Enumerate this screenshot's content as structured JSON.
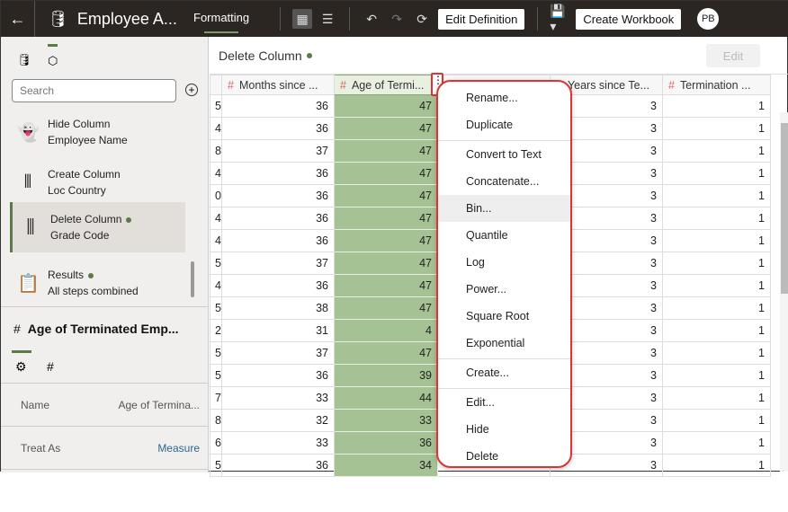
{
  "header": {
    "title": "Employee A...",
    "formatting_tab": "Formatting",
    "edit_definition": "Edit Definition",
    "create_workbook": "Create Workbook",
    "avatar": "PB"
  },
  "sidebar": {
    "search_placeholder": "Search",
    "steps": [
      {
        "title": "Hide Column",
        "subtitle": "Employee Name",
        "icon": "ghost-icon"
      },
      {
        "title": "Create Column",
        "subtitle": "Loc Country",
        "icon": "create-column-icon"
      },
      {
        "title": "Delete Column",
        "subtitle": "Grade Code",
        "icon": "delete-column-icon",
        "selected": true
      },
      {
        "title": "Results",
        "subtitle": "All steps combined",
        "icon": "results-icon"
      }
    ],
    "properties": {
      "title": "Age of Terminated Emp...",
      "rows": [
        {
          "label": "Name",
          "value": "Age of Termina..."
        },
        {
          "label": "Treat As",
          "value": "Measure"
        }
      ]
    }
  },
  "main": {
    "step_title": "Delete Column",
    "edit_label": "Edit",
    "columns": [
      "",
      "Months since ...",
      "Age of Termi...",
      "",
      "Years since Te...",
      "Termination ..."
    ],
    "rows": [
      [
        "5",
        "36",
        "47",
        "",
        "3",
        "1"
      ],
      [
        "4",
        "36",
        "47",
        "",
        "3",
        "1"
      ],
      [
        "8",
        "37",
        "47",
        "",
        "3",
        "1"
      ],
      [
        "4",
        "36",
        "47",
        "",
        "3",
        "1"
      ],
      [
        "0",
        "36",
        "47",
        "",
        "3",
        "1"
      ],
      [
        "4",
        "36",
        "47",
        "",
        "3",
        "1"
      ],
      [
        "4",
        "36",
        "47",
        "",
        "3",
        "1"
      ],
      [
        "5",
        "37",
        "47",
        "",
        "3",
        "1"
      ],
      [
        "4",
        "36",
        "47",
        "",
        "3",
        "1"
      ],
      [
        "5",
        "38",
        "47",
        "",
        "3",
        "1"
      ],
      [
        "2",
        "31",
        "4",
        "",
        "3",
        "1"
      ],
      [
        "5",
        "37",
        "47",
        "",
        "3",
        "1"
      ],
      [
        "5",
        "36",
        "39",
        "",
        "3",
        "1"
      ],
      [
        "7",
        "33",
        "44",
        "",
        "3",
        "1"
      ],
      [
        "8",
        "32",
        "33",
        "",
        "3",
        "1"
      ],
      [
        "6",
        "33",
        "36",
        "",
        "3",
        "1"
      ],
      [
        "5",
        "36",
        "34",
        "",
        "3",
        "1"
      ]
    ]
  },
  "context_menu": {
    "items": [
      "Rename...",
      "Duplicate",
      "Convert to Text",
      "Concatenate...",
      "Bin...",
      "Quantile",
      "Log",
      "Power...",
      "Square Root",
      "Exponential",
      "Create...",
      "Edit...",
      "Hide",
      "Delete"
    ],
    "highlighted": "Bin..."
  },
  "colors": {
    "accent": "#5b7a4a",
    "selected_column": "#a5c294",
    "menu_outline": "#d33333"
  }
}
